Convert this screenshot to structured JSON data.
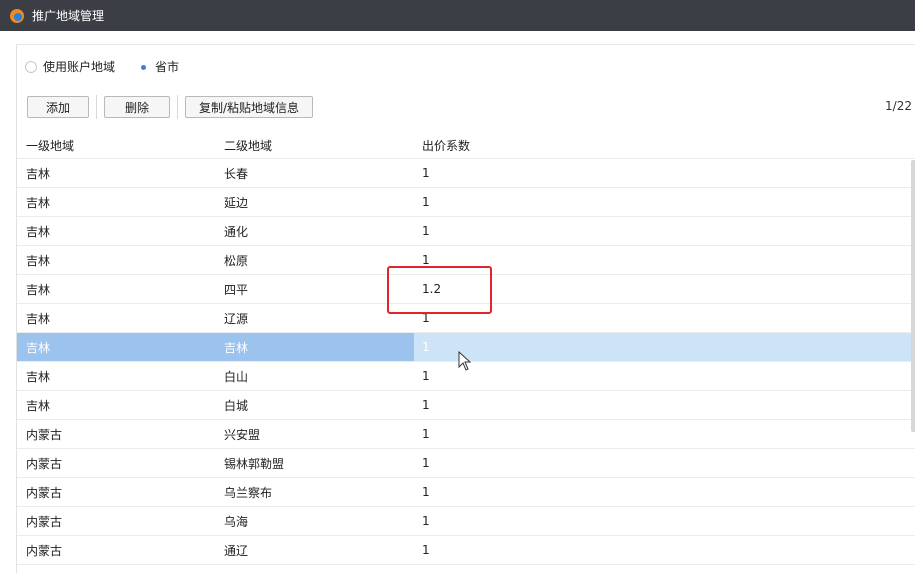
{
  "window": {
    "title": "推广地域管理"
  },
  "radios": [
    {
      "label": "使用账户地域",
      "checked": false
    },
    {
      "label": "省市",
      "checked": true
    }
  ],
  "toolbar": {
    "add_label": "添加",
    "delete_label": "删除",
    "copy_label": "复制/粘贴地域信息",
    "pager": "1/22"
  },
  "table": {
    "headers": [
      "一级地域",
      "二级地域",
      "出价系数"
    ],
    "rows": [
      {
        "region1": "吉林",
        "region2": "长春",
        "coef": "1"
      },
      {
        "region1": "吉林",
        "region2": "延边",
        "coef": "1"
      },
      {
        "region1": "吉林",
        "region2": "通化",
        "coef": "1"
      },
      {
        "region1": "吉林",
        "region2": "松原",
        "coef": "1"
      },
      {
        "region1": "吉林",
        "region2": "四平",
        "coef": "1.2"
      },
      {
        "region1": "吉林",
        "region2": "辽源",
        "coef": "1"
      },
      {
        "region1": "吉林",
        "region2": "吉林",
        "coef": "1"
      },
      {
        "region1": "吉林",
        "region2": "白山",
        "coef": "1"
      },
      {
        "region1": "吉林",
        "region2": "白城",
        "coef": "1"
      },
      {
        "region1": "内蒙古",
        "region2": "兴安盟",
        "coef": "1"
      },
      {
        "region1": "内蒙古",
        "region2": "锡林郭勒盟",
        "coef": "1"
      },
      {
        "region1": "内蒙古",
        "region2": "乌兰察布",
        "coef": "1"
      },
      {
        "region1": "内蒙古",
        "region2": "乌海",
        "coef": "1"
      },
      {
        "region1": "内蒙古",
        "region2": "通辽",
        "coef": "1"
      }
    ],
    "selected_row": 6
  },
  "colors": {
    "titlebar": "#3b3f45",
    "selection": "#9cc3ee",
    "highlight": "#e0262b",
    "radio_checked": "#3a7fe0"
  },
  "icons": [
    "app-logo-icon",
    "mouse-cursor-icon"
  ]
}
